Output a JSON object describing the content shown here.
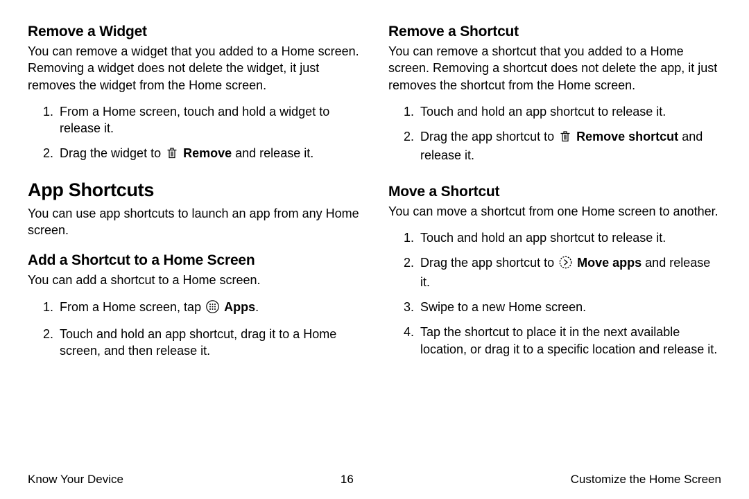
{
  "left": {
    "sec1": {
      "heading": "Remove a Widget",
      "desc": "You can remove a widget that you added to a Home screen. Removing a widget does not delete the widget, it just removes the widget from the Home screen.",
      "step1": "From a Home screen, touch and hold a widget to release it.",
      "step2_pre": "Drag the widget to ",
      "step2_bold": "Remove",
      "step2_post": " and release it."
    },
    "sec2": {
      "heading": "App Shortcuts",
      "desc": "You can use app shortcuts to launch an app from any Home screen.",
      "sub1": {
        "heading": "Add a Shortcut to a Home Screen",
        "desc": "You can add a shortcut to a Home screen.",
        "step1_pre": "From a Home screen, tap ",
        "step1_bold": "Apps",
        "step1_post": ".",
        "step2": "Touch and hold an app shortcut, drag it to a Home screen, and then release it."
      }
    }
  },
  "right": {
    "sec1": {
      "heading": "Remove a Shortcut",
      "desc": "You can remove a shortcut that you added to a Home screen. Removing a shortcut does not delete the app, it just removes the shortcut from the Home screen.",
      "step1": "Touch and hold an app shortcut to release it.",
      "step2_pre": "Drag the app shortcut to ",
      "step2_bold": "Remove shortcut",
      "step2_post": " and release it."
    },
    "sec2": {
      "heading": "Move a Shortcut",
      "desc": "You can move a shortcut from one Home screen to another.",
      "step1": "Touch and hold an app shortcut to release it.",
      "step2_pre": "Drag the app shortcut to ",
      "step2_bold": "Move apps",
      "step2_post": " and release it.",
      "step3": "Swipe to a new Home screen.",
      "step4": "Tap the shortcut to place it in the next available location, or drag it to a specific location and release it."
    }
  },
  "footer": {
    "left": "Know Your Device",
    "center": "16",
    "right": "Customize the Home Screen"
  }
}
